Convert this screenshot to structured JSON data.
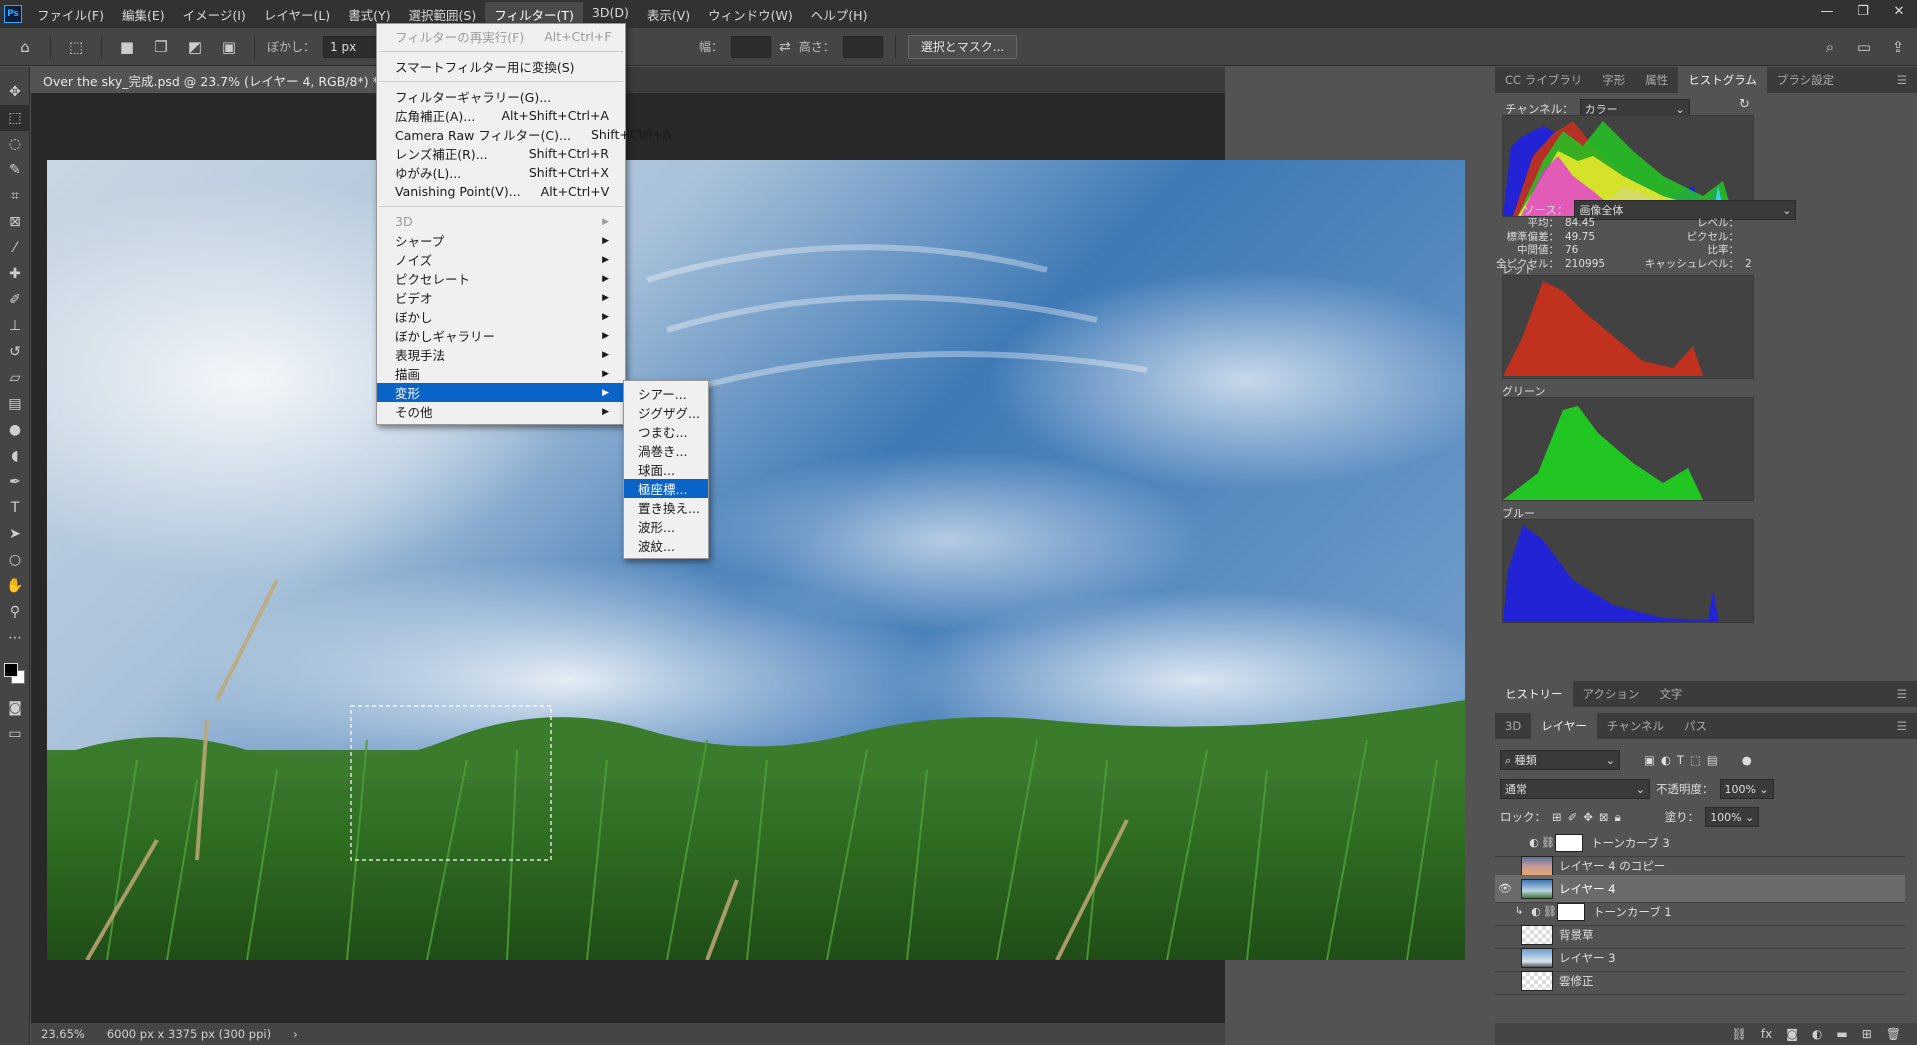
{
  "menubar": {
    "logo": "Ps",
    "items": [
      "ファイル(F)",
      "編集(E)",
      "イメージ(I)",
      "レイヤー(L)",
      "書式(Y)",
      "選択範囲(S)",
      "フィルター(T)",
      "3D(D)",
      "表示(V)",
      "ウィンドウ(W)",
      "ヘルプ(H)"
    ],
    "active_index": 6,
    "window_controls": [
      "—",
      "❐",
      "✕"
    ]
  },
  "options": {
    "feather_label": "ぼかし：",
    "feather_value": "1 px",
    "width_label": "幅：",
    "height_label": "高さ：",
    "select_mask_button": "選択とマスク..."
  },
  "document": {
    "tab_title": "Over the sky_完成.psd @ 23.7% (レイヤー 4, RGB/8*) *",
    "tab_close": "×"
  },
  "status": {
    "zoom": "23.65%",
    "dimensions": "6000 px x 3375 px (300 ppi)",
    "arrow": "›"
  },
  "filter_menu": {
    "items": [
      {
        "label": "フィルターの再実行(F)",
        "shortcut": "Alt+Ctrl+F",
        "disabled": true
      },
      {
        "sep": true
      },
      {
        "label": "スマートフィルター用に変換(S)",
        "shortcut": ""
      },
      {
        "sep": true
      },
      {
        "label": "フィルターギャラリー(G)...",
        "shortcut": ""
      },
      {
        "label": "広角補正(A)...",
        "shortcut": "Alt+Shift+Ctrl+A"
      },
      {
        "label": "Camera Raw フィルター(C)...",
        "shortcut": "Shift+Ctrl+A"
      },
      {
        "label": "レンズ補正(R)...",
        "shortcut": "Shift+Ctrl+R"
      },
      {
        "label": "ゆがみ(L)...",
        "shortcut": "Shift+Ctrl+X"
      },
      {
        "label": "Vanishing Point(V)...",
        "shortcut": "Alt+Ctrl+V"
      },
      {
        "sep": true
      },
      {
        "label": "3D",
        "submenu": true,
        "disabled": true
      },
      {
        "label": "シャープ",
        "submenu": true
      },
      {
        "label": "ノイズ",
        "submenu": true
      },
      {
        "label": "ピクセレート",
        "submenu": true
      },
      {
        "label": "ビデオ",
        "submenu": true
      },
      {
        "label": "ぼかし",
        "submenu": true
      },
      {
        "label": "ぼかしギャラリー",
        "submenu": true
      },
      {
        "label": "表現手法",
        "submenu": true
      },
      {
        "label": "描画",
        "submenu": true
      },
      {
        "label": "変形",
        "submenu": true,
        "highlighted": true
      },
      {
        "label": "その他",
        "submenu": true
      }
    ]
  },
  "distort_submenu": {
    "items": [
      "シアー...",
      "ジグザグ...",
      "つまむ...",
      "渦巻き...",
      "球面...",
      "極座標...",
      "置き換え...",
      "波形...",
      "波紋..."
    ],
    "highlighted_index": 5
  },
  "histogram_panel": {
    "tabs": [
      "CC ライブラリ",
      "字形",
      "属性",
      "ヒストグラム",
      "ブラシ設定"
    ],
    "active_tab": 3,
    "channel_label": "チャンネル：",
    "channel_value": "カラー",
    "source_label": "ソース：",
    "source_value": "画像全体",
    "stats": [
      {
        "k": "平均：",
        "v": "84.45",
        "k2": "レベル：",
        "v2": ""
      },
      {
        "k": "標準偏差：",
        "v": "49.75",
        "k2": "ピクセル：",
        "v2": ""
      },
      {
        "k": "中間値：",
        "v": "76",
        "k2": "比率：",
        "v2": ""
      },
      {
        "k": "全ピクセル：",
        "v": "210995",
        "k2": "キャッシュレベル：",
        "v2": "2"
      }
    ],
    "channels": [
      "レッド",
      "グリーン",
      "ブルー"
    ],
    "colors": {
      "red": "#c0311e",
      "green": "#22c622",
      "blue": "#2323d6"
    }
  },
  "history_panel": {
    "tabs": [
      "ヒストリー",
      "アクション",
      "文字"
    ],
    "active_tab": 0
  },
  "layers_panel": {
    "tabs": [
      "3D",
      "レイヤー",
      "チャンネル",
      "パス"
    ],
    "active_tab": 1,
    "filter_value": "種類",
    "blend_mode": "通常",
    "opacity_label": "不透明度：",
    "opacity_value": "100%",
    "lock_label": "ロック：",
    "fill_label": "塗り：",
    "fill_value": "100%",
    "layers": [
      {
        "name": "トーンカーブ 3",
        "type": "adjustment",
        "visible": false,
        "selected": false
      },
      {
        "name": "レイヤー 4 のコピー",
        "type": "sunset",
        "visible": false,
        "selected": false
      },
      {
        "name": "レイヤー 4",
        "type": "sky",
        "visible": true,
        "selected": true
      },
      {
        "name": "トーンカーブ 1",
        "type": "adjustment-clipped",
        "visible": false,
        "selected": false
      },
      {
        "name": "背景草",
        "type": "transparent",
        "visible": false,
        "selected": false
      },
      {
        "name": "レイヤー 3",
        "type": "sky2",
        "visible": false,
        "selected": false
      },
      {
        "name": "雲修正",
        "type": "transparent",
        "visible": false,
        "selected": false
      }
    ]
  }
}
